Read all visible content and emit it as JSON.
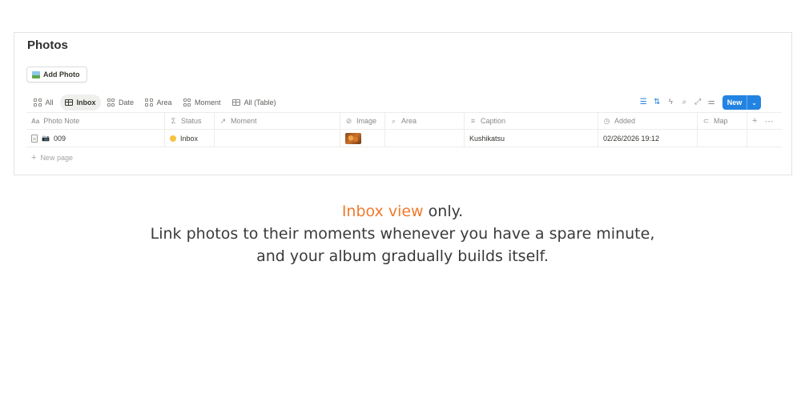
{
  "page": {
    "title": "Photos"
  },
  "colors": {
    "accent": "#ee7b2d",
    "primary_button": "#2383e2",
    "status_dot": "#f6c343"
  },
  "actions": {
    "add_photo_label": "Add Photo",
    "add_photo_icon": "picture-icon"
  },
  "views": [
    {
      "label": "All",
      "icon": "grid-icon",
      "active": false
    },
    {
      "label": "Inbox",
      "icon": "table-icon",
      "active": true
    },
    {
      "label": "Date",
      "icon": "grid-icon",
      "active": false
    },
    {
      "label": "Area",
      "icon": "grid-icon",
      "active": false
    },
    {
      "label": "Moment",
      "icon": "grid-icon",
      "active": false
    },
    {
      "label": "All (Table)",
      "icon": "table-icon",
      "active": false
    }
  ],
  "toolbar": {
    "icons": [
      "filter-icon",
      "sort-icon",
      "lightning-icon",
      "search-icon",
      "expand-icon",
      "settings-icon"
    ],
    "new_label": "New"
  },
  "table": {
    "columns": [
      {
        "label": "Photo Note",
        "icon": "text-icon",
        "icon_glyph": "Aa"
      },
      {
        "label": "Status",
        "icon": "sigma-icon",
        "icon_glyph": "Σ"
      },
      {
        "label": "Moment",
        "icon": "relation-arrow-icon",
        "icon_glyph": "↗"
      },
      {
        "label": "Image",
        "icon": "paperclip-icon",
        "icon_glyph": "⊘"
      },
      {
        "label": "Area",
        "icon": "search-icon",
        "icon_glyph": "⌕"
      },
      {
        "label": "Caption",
        "icon": "lines-icon",
        "icon_glyph": "≡"
      },
      {
        "label": "Added",
        "icon": "clock-icon",
        "icon_glyph": "◷"
      },
      {
        "label": "Map",
        "icon": "link-icon",
        "icon_glyph": "⊂"
      }
    ],
    "rows": [
      {
        "photo_note": "009",
        "status": "Inbox",
        "moment": "",
        "image": "food-thumbnail",
        "area": "",
        "caption": "Kushikatsu",
        "added": "02/26/2026 19:12",
        "map": ""
      }
    ],
    "new_page_label": "New page"
  },
  "caption": {
    "highlight": "Inbox view",
    "line1_rest": " only.",
    "line2": "Link photos to their moments whenever you have a spare minute,",
    "line3": "and your album gradually builds itself."
  }
}
